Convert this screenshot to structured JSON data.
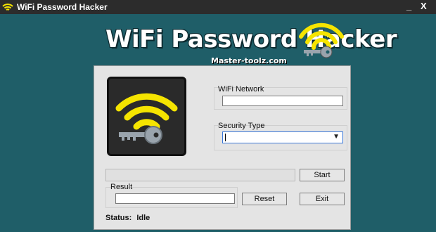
{
  "window": {
    "title": "WiFi Password Hacker",
    "minimize_glyph": "_",
    "close_glyph": "X"
  },
  "banner": {
    "title": "WiFi Password Hacker",
    "subtitle": "Master-toolz.com",
    "logo_icon": "wifi-key-icon"
  },
  "form": {
    "wifi_network_label": "WiFi Network",
    "wifi_network_value": "",
    "security_type_label": "Security Type",
    "security_type_value": "",
    "result_label": "Result",
    "result_value": ""
  },
  "buttons": {
    "start": "Start",
    "reset": "Reset",
    "exit": "Exit"
  },
  "status": {
    "label": "Status:",
    "value": "Idle"
  },
  "progress": 0,
  "colors": {
    "background": "#1f5e68",
    "panel": "#e4e4e4",
    "wifi_yellow": "#f5e400",
    "titlebar": "#2c2c2c",
    "key_gray": "#9aa4ad"
  }
}
